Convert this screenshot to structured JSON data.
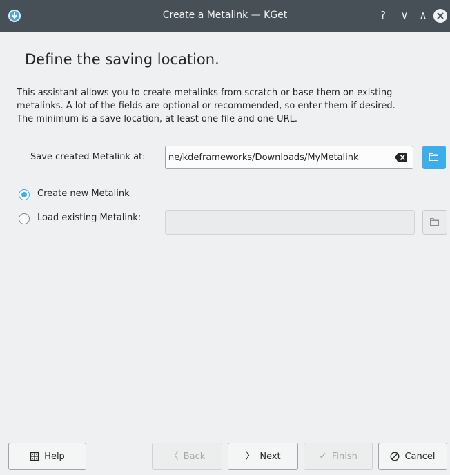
{
  "window": {
    "title": "Create a Metalink — KGet"
  },
  "titlebar_buttons": {
    "help": "?",
    "minimize": "∨",
    "maximize": "∧"
  },
  "page": {
    "heading": "Define the saving location.",
    "description_lines": [
      "This assistant allows you to create metalinks from scratch or base them on existing",
      "metalinks. A lot of the fields are optional or recommended, so enter them if desired.",
      "The minimum is a save location, at least one file and one URL."
    ]
  },
  "save": {
    "label": "Save created Metalink at:",
    "value": "ne/kdeframeworks/Downloads/MyMetalink"
  },
  "options": {
    "create_new": {
      "label": "Create new Metalink",
      "checked": true
    },
    "load_existing": {
      "label": "Load existing Metalink:",
      "checked": false,
      "value": ""
    }
  },
  "buttons": {
    "help": "Help",
    "back": "Back",
    "next": "Next",
    "finish": "Finish",
    "cancel": "Cancel"
  },
  "colors": {
    "accent": "#3daee9",
    "titlebar": "#475057",
    "background": "#eff0f1"
  },
  "icons": [
    "kget-app-icon",
    "help-icon",
    "minimize-icon",
    "maximize-icon",
    "close-icon",
    "clear-text-icon",
    "folder-icon",
    "help-book-icon",
    "chevron-left-icon",
    "chevron-right-icon",
    "checkmark-icon",
    "cancel-icon"
  ]
}
